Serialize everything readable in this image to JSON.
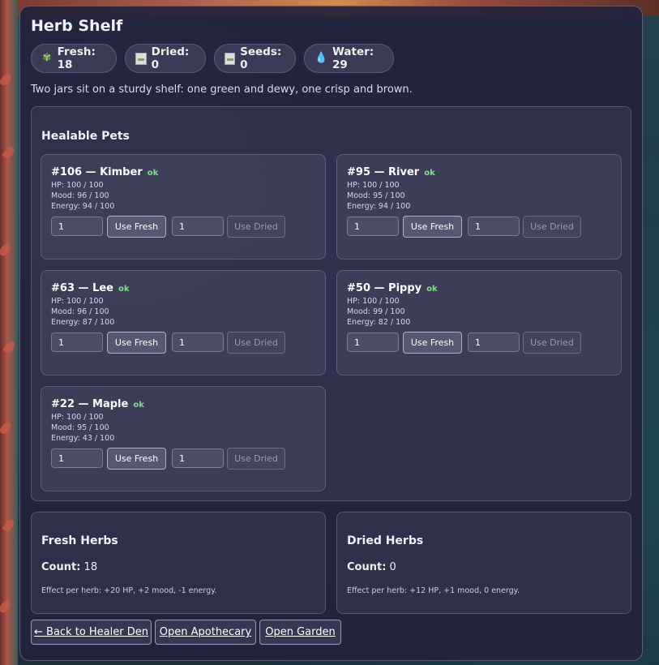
{
  "page": {
    "title": "Herb Shelf",
    "description": "Two jars sit on a sturdy shelf: one green and dewy, one crisp and brown."
  },
  "stats": [
    {
      "label": "Fresh: 18",
      "icon": "herb-icon"
    },
    {
      "label": "Dried: 0",
      "icon": "broken-image-icon"
    },
    {
      "label": "Seeds: 0",
      "icon": "broken-image-icon"
    },
    {
      "label": "Water: 29",
      "icon": "water-drop-icon"
    }
  ],
  "healable": {
    "title": "Healable Pets",
    "pets": [
      {
        "name": "#106 — Kimber",
        "status": "ok",
        "hp": "HP: 100 / 100",
        "mood": "Mood: 96 / 100",
        "energy": "Energy: 94 / 100",
        "fresh_qty": "1",
        "dried_qty": "1",
        "fresh_label": "Use Fresh",
        "dried_label": "Use Dried"
      },
      {
        "name": "#95 — River",
        "status": "ok",
        "hp": "HP: 100 / 100",
        "mood": "Mood: 95 / 100",
        "energy": "Energy: 94 / 100",
        "fresh_qty": "1",
        "dried_qty": "1",
        "fresh_label": "Use Fresh",
        "dried_label": "Use Dried"
      },
      {
        "name": "#63 — Lee",
        "status": "ok",
        "hp": "HP: 100 / 100",
        "mood": "Mood: 96 / 100",
        "energy": "Energy: 87 / 100",
        "fresh_qty": "1",
        "dried_qty": "1",
        "fresh_label": "Use Fresh",
        "dried_label": "Use Dried"
      },
      {
        "name": "#50 — Pippy",
        "status": "ok",
        "hp": "HP: 100 / 100",
        "mood": "Mood: 99 / 100",
        "energy": "Energy: 82 / 100",
        "fresh_qty": "1",
        "dried_qty": "1",
        "fresh_label": "Use Fresh",
        "dried_label": "Use Dried"
      },
      {
        "name": "#22 — Maple",
        "status": "ok",
        "hp": "HP: 100 / 100",
        "mood": "Mood: 95 / 100",
        "energy": "Energy: 43 / 100",
        "fresh_qty": "1",
        "dried_qty": "1",
        "fresh_label": "Use Fresh",
        "dried_label": "Use Dried"
      }
    ]
  },
  "fresh_herbs": {
    "title": "Fresh Herbs",
    "count_label": "Count:",
    "count": "18",
    "effect": "Effect per herb: +20 HP, +2 mood, -1 energy."
  },
  "dried_herbs": {
    "title": "Dried Herbs",
    "count_label": "Count:",
    "count": "0",
    "effect": "Effect per herb: +12 HP, +1 mood, 0 energy."
  },
  "nav": {
    "back": "← Back to Healer Den",
    "apothecary": "Open Apothecary",
    "garden": "Open Garden"
  },
  "colors": {
    "ok_green": "#7ee08a",
    "panel_bg": "#23223c"
  }
}
